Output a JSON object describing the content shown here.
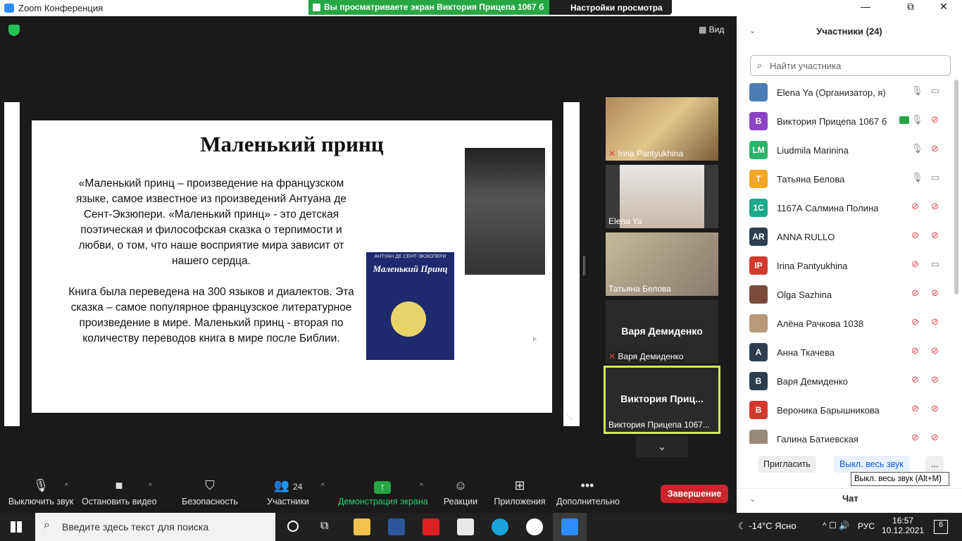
{
  "window": {
    "title": "Zoom Конференция",
    "minimize": "—",
    "restore": "⧉",
    "close": "✕"
  },
  "banner": {
    "sharing": "Вы просматриваете экран Виктория Прицепа 1067 б",
    "view_options": "Настройки просмотра ⌄"
  },
  "view_button": "Вид",
  "slide": {
    "title": "Маленький принц",
    "para1": "«Маленький принц – произведение на французском языке, самое известное из произведений Антуана де Сент-Экзюпери. «Маленький принц» - это детская поэтическая и философская сказка о терпимости и любви, о том, что наше восприятие мира зависит от нашего сердца.",
    "para2": "Книга была переведена на 300 языков и диалектов. Эта сказка – самое популярное французское литературное произведение в мире. Маленький принц - вторая по количеству переводов книга в мире после Библии.",
    "book_author": "АНТУАН ДЕ СЕНТ-ЭКЗЮПЕРИ",
    "book_title": "Маленький Принц"
  },
  "tiles": [
    {
      "name": "Irina Pantyukhina",
      "big": ""
    },
    {
      "name": "Elena Ya",
      "big": ""
    },
    {
      "name": "Татьяна Белова",
      "big": ""
    },
    {
      "name": "Варя Демиденко",
      "big": "Варя Демиденко"
    },
    {
      "name": "Виктория Прицепа 1067...",
      "big": "Виктория  Приц..."
    }
  ],
  "toolbar": {
    "mute": "Выключить звук",
    "video": "Остановить видео",
    "security": "Безопасность",
    "participants": "Участники",
    "participants_count": "24",
    "share": "Демонстрация экрана",
    "reactions": "Реакции",
    "apps": "Приложения",
    "more": "Дополнительно",
    "end": "Завершение"
  },
  "panel": {
    "title": "Участники (24)",
    "search_placeholder": "Найти участника",
    "participants": [
      {
        "initials": "",
        "name": "Elena Ya (Организатор, я)",
        "color": "#4a7db5"
      },
      {
        "initials": "В",
        "name": "Виктория Прицепа 1067 б",
        "color": "#8b44c4"
      },
      {
        "initials": "LM",
        "name": "Liudmila Marinina",
        "color": "#2db36b"
      },
      {
        "initials": "Т",
        "name": "Татьяна Белова",
        "color": "#f5a623"
      },
      {
        "initials": "1С",
        "name": "1167А Салмина Полина",
        "color": "#1aa98b"
      },
      {
        "initials": "AR",
        "name": "ANNA RULLO",
        "color": "#2c3e50"
      },
      {
        "initials": "IP",
        "name": "Irina Pantyukhina",
        "color": "#d0392b"
      },
      {
        "initials": "",
        "name": "Olga Sazhina",
        "color": "#7a4a3a"
      },
      {
        "initials": "",
        "name": "Алёна Рачкова 1038",
        "color": "#b89a7a"
      },
      {
        "initials": "А",
        "name": "Анна Ткачева",
        "color": "#2c3e50"
      },
      {
        "initials": "В",
        "name": "Варя Демиденко",
        "color": "#2c3e50"
      },
      {
        "initials": "В",
        "name": "Вероника Барышникова",
        "color": "#d0392b"
      },
      {
        "initials": "",
        "name": "Галина Батиевская",
        "color": "#9a8a7a"
      }
    ],
    "invite": "Пригласить",
    "mute_all": "Выкл. весь звук",
    "more": "...",
    "tooltip": "Выкл. весь звук (Alt+M)",
    "chat": "Чат"
  },
  "taskbar": {
    "search": "Введите здесь текст для поиска",
    "weather": "-14°C  Ясно",
    "lang": "РУС",
    "time": "16:57",
    "date": "10.12.2021",
    "notif": "6"
  }
}
